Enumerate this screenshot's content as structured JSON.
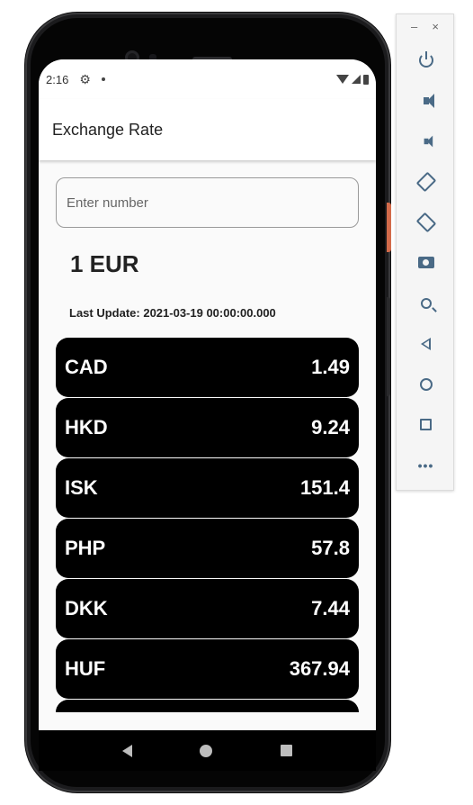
{
  "status_bar": {
    "time": "2:16",
    "settings_icon": "gear-icon"
  },
  "app_bar": {
    "title": "Exchange Rate"
  },
  "amount_input": {
    "placeholder": "Enter number",
    "value": ""
  },
  "base_currency": "1 EUR",
  "last_update": "Last Update: 2021-03-19 00:00:00.000",
  "rates": [
    {
      "code": "CAD",
      "value": "1.49"
    },
    {
      "code": "HKD",
      "value": "9.24"
    },
    {
      "code": "ISK",
      "value": "151.4"
    },
    {
      "code": "PHP",
      "value": "57.8"
    },
    {
      "code": "DKK",
      "value": "7.44"
    },
    {
      "code": "HUF",
      "value": "367.94"
    },
    {
      "code": "",
      "value": ""
    }
  ],
  "emulator_panel": {
    "window_controls": [
      "–",
      "×"
    ],
    "buttons": [
      "power-icon",
      "volume-up-icon",
      "volume-down-icon",
      "rotate-left-icon",
      "rotate-right-icon",
      "camera-icon",
      "zoom-icon",
      "back-icon",
      "home-icon",
      "overview-icon",
      "more-icon"
    ]
  },
  "colors": {
    "card_bg": "#000000",
    "card_text": "#ffffff",
    "screen_bg": "#fafafa",
    "panel_icon": "#4a6a86"
  }
}
